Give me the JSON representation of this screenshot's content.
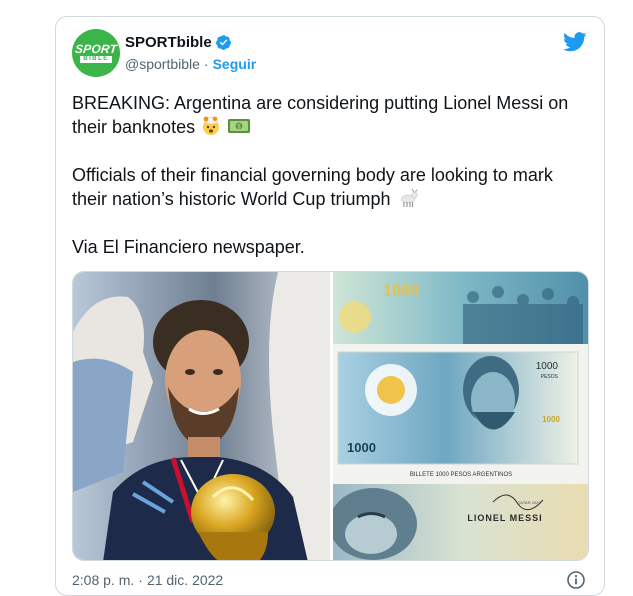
{
  "account": {
    "display_name": "SPORTbible",
    "handle": "@sportbible",
    "separator": "·",
    "follow_label": "Seguir",
    "avatar_text_main": "SPORT",
    "avatar_text_sub": "BIBLE"
  },
  "tweet": {
    "paragraph_1": "BREAKING: Argentina are considering putting Lionel Messi on their banknotes",
    "paragraph_2": "Officials of their financial governing body are looking to mark their nation’s historic World Cup triumph",
    "paragraph_3": "Via El Financiero newspaper.",
    "emoji_1": "mind-blown-emoji",
    "emoji_2": "dollar-banknote-emoji",
    "emoji_3": "goat-emoji"
  },
  "media": {
    "banknote_value": "1000",
    "banknote_small_value": "1000",
    "banknote_word": "PESOS",
    "banknote_caption": "BILLETE 1000 PESOS ARGENTINOS",
    "banknote_name": "LIONEL MESSI",
    "banknote_tiny": "QATAR 2022"
  },
  "meta": {
    "time": "2:08 p. m.",
    "separator": "·",
    "date": "21 dic. 2022"
  },
  "colors": {
    "brand_green": "#3bb44a",
    "link_blue": "#1d9bf0",
    "text_primary": "#0f1419",
    "text_secondary": "#536471"
  },
  "icons": {
    "verified": "verified-badge-icon",
    "bird": "twitter-bird-icon",
    "info": "info-icon"
  }
}
